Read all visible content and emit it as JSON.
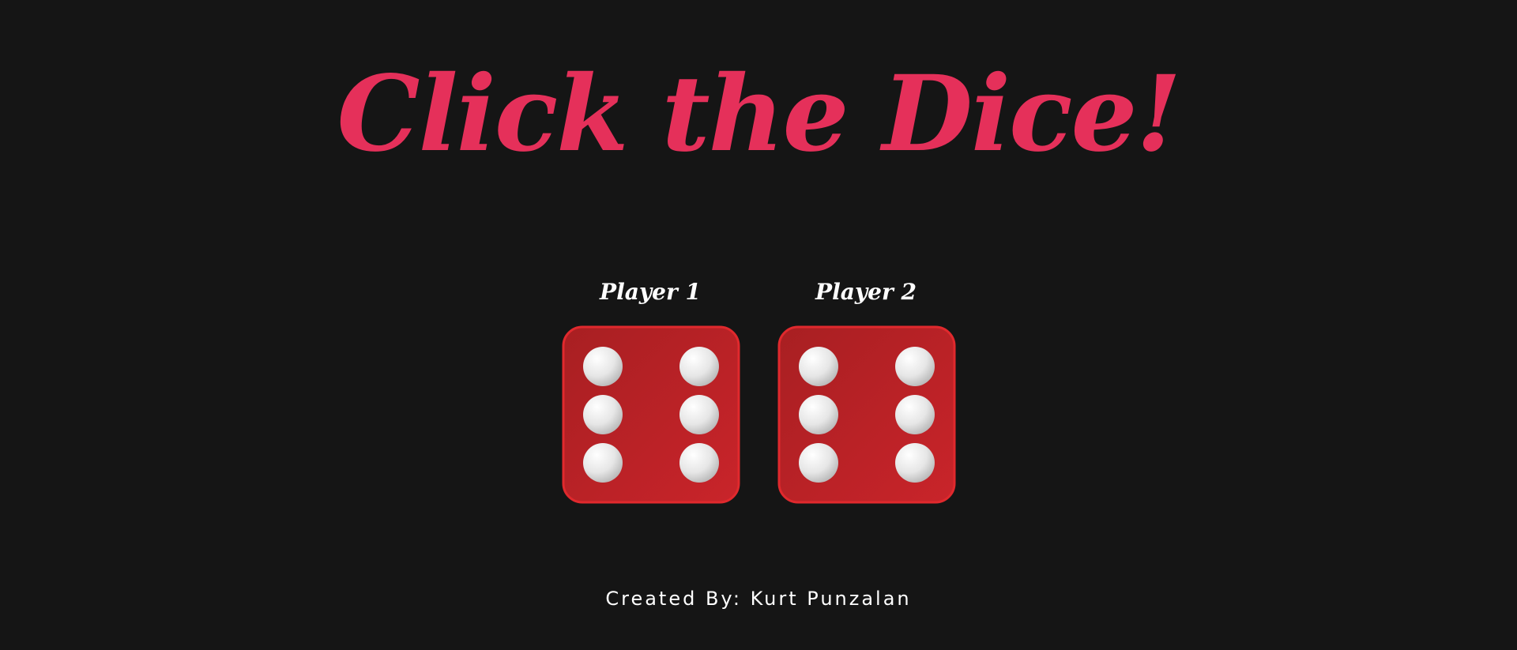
{
  "header": {
    "title": "Click the Dice!"
  },
  "players": [
    {
      "label": "Player 1",
      "die_face": 6
    },
    {
      "label": "Player 2",
      "die_face": 6
    }
  ],
  "footer": {
    "credit": "Created By: Kurt Punzalan"
  },
  "colors": {
    "background": "#151515",
    "title": "#E5305A",
    "die_body": "#C42326",
    "die_edge": "#E0292D",
    "pip": "#E8E8E8",
    "text": "#FFFFFF"
  }
}
